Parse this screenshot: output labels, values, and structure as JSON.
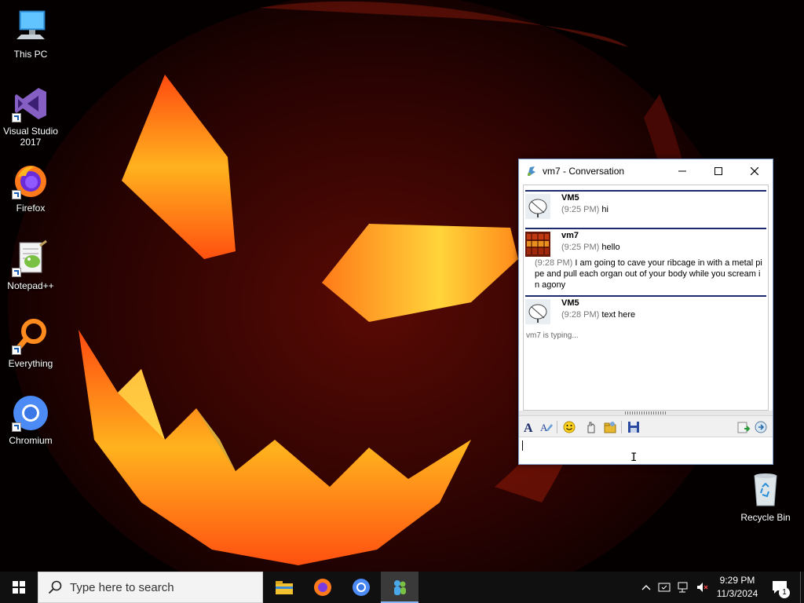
{
  "desktop": {
    "icons": [
      {
        "label_line1": "This PC",
        "label_line2": ""
      },
      {
        "label_line1": "Visual Studio",
        "label_line2": "2017"
      },
      {
        "label_line1": "Firefox",
        "label_line2": ""
      },
      {
        "label_line1": "Notepad++",
        "label_line2": ""
      },
      {
        "label_line1": "Everything",
        "label_line2": ""
      },
      {
        "label_line1": "Chromium",
        "label_line2": ""
      }
    ],
    "recycle_bin": "Recycle Bin"
  },
  "window": {
    "title": "vm7 - Conversation",
    "messages": [
      {
        "sender": "VM5",
        "time": "(9:25 PM)",
        "text": "hi"
      },
      {
        "sender": "vm7",
        "time": "(9:25 PM)",
        "text": "hello",
        "followup_time": "(9:28 PM)",
        "followup_text": "I am going to cave your ribcage in with a metal pipe and pull each organ out of your body while you scream in agony"
      },
      {
        "sender": "VM5",
        "time": "(9:28 PM)",
        "text": "text here"
      }
    ],
    "typing_status": "vm7 is typing..."
  },
  "taskbar": {
    "search_placeholder": "Type here to search",
    "clock_time": "9:29 PM",
    "clock_date": "11/3/2024",
    "notification_count": "1"
  },
  "colors": {
    "message_separator": "#1c2a6e",
    "taskbar": "#101010",
    "active_app": "#3a3a3a"
  }
}
